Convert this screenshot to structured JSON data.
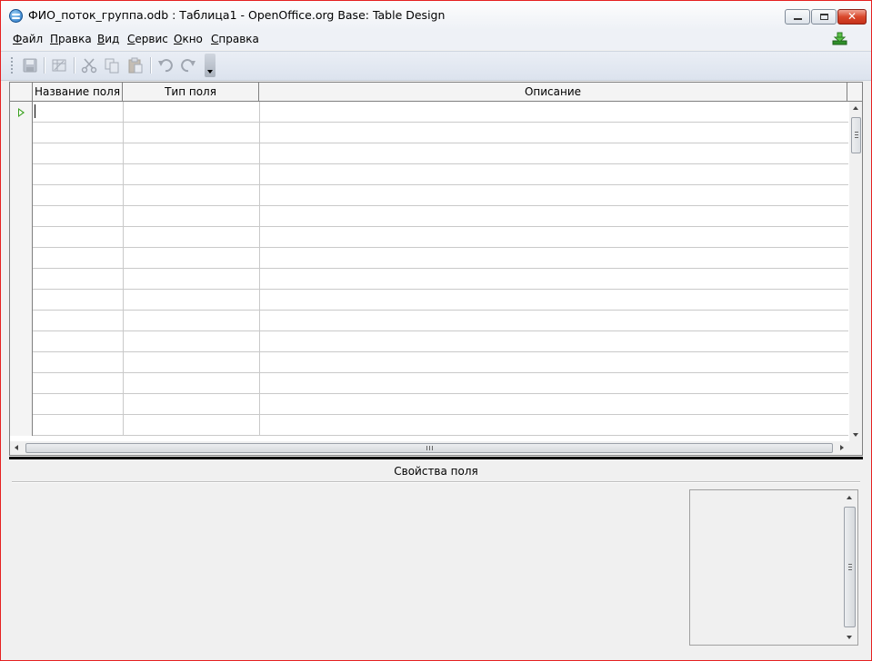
{
  "window": {
    "title": "ФИО_поток_группа.odb : Таблица1 - OpenOffice.org Base: Table Design",
    "accent_border_color": "#e52020",
    "controls": [
      "minimize-icon",
      "maximize-icon",
      "close-icon"
    ],
    "close_glyph": "✕"
  },
  "menubar": {
    "items": [
      {
        "label": "Файл"
      },
      {
        "label": "Правка"
      },
      {
        "label": "Вид"
      },
      {
        "label": "Сервис"
      },
      {
        "label": "Окно"
      },
      {
        "label": "Справка"
      }
    ],
    "update_icon": "download-update-icon"
  },
  "toolbar": {
    "buttons": [
      "save-icon",
      "table-properties-icon",
      "cut-icon",
      "copy-icon",
      "paste-icon",
      "undo-icon",
      "redo-icon"
    ],
    "enabled": false
  },
  "table_design": {
    "columns": [
      {
        "label": ""
      },
      {
        "label": "Название поля"
      },
      {
        "label": "Тип поля"
      },
      {
        "label": "Описание"
      }
    ],
    "visible_rows": 16,
    "current_row": 1,
    "current_row_marker_color": "#3aa01e"
  },
  "field_properties": {
    "title": "Свойства поля"
  }
}
